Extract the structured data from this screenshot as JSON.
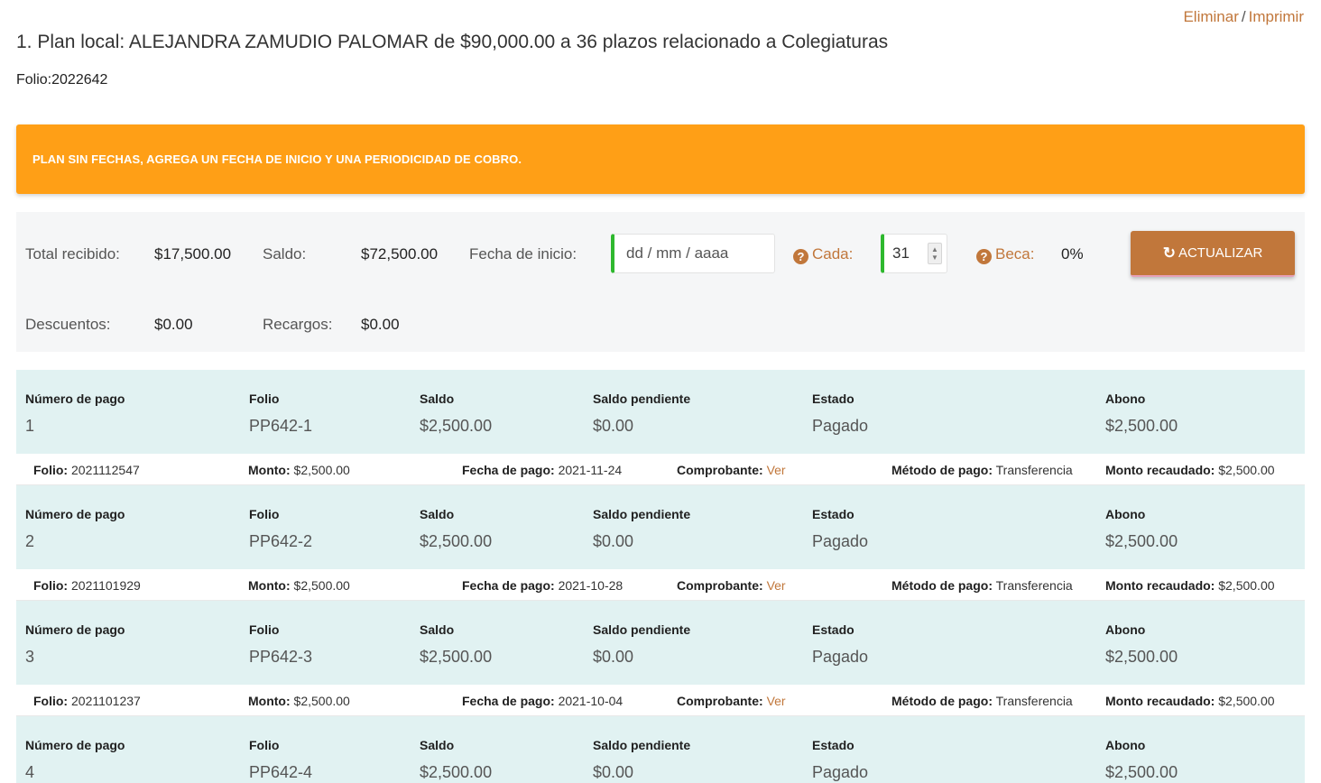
{
  "links": {
    "delete": "Eliminar",
    "separator": "/",
    "print": "Imprimir"
  },
  "title": "1. Plan local: ALEJANDRA ZAMUDIO PALOMAR de $90,000.00 a 36 plazos relacionado a Colegiaturas",
  "folio": "Folio:2022642",
  "alert": "PLAN SIN FECHAS, AGREGA UN FECHA DE INICIO Y UNA PERIODICIDAD DE COBRO.",
  "summary": {
    "total_recibido_label": "Total recibido:",
    "total_recibido": "$17,500.00",
    "saldo_label": "Saldo:",
    "saldo": "$72,500.00",
    "fecha_inicio_label": "Fecha de inicio:",
    "fecha_inicio_placeholder": "dd / mm / aaaa",
    "cada_label": "Cada:",
    "cada_value": "31",
    "beca_label": "Beca:",
    "beca_value": "0%",
    "actualizar_label": "ACTUALIZAR",
    "descuentos_label": "Descuentos:",
    "descuentos": "$0.00",
    "recargos_label": "Recargos:",
    "recargos": "$0.00"
  },
  "columns": {
    "numero": "Número de pago",
    "folio": "Folio",
    "saldo": "Saldo",
    "saldo_pendiente": "Saldo pendiente",
    "estado": "Estado",
    "abono": "Abono"
  },
  "detail_labels": {
    "folio": "Folio:",
    "monto": "Monto:",
    "fecha": "Fecha de pago:",
    "comprobante": "Comprobante:",
    "metodo": "Método de pago:",
    "recaudado": "Monto recaudado:"
  },
  "payments": [
    {
      "numero": "1",
      "folio": "PP642-1",
      "saldo": "$2,500.00",
      "saldo_pendiente": "$0.00",
      "estado": "Pagado",
      "abono": "$2,500.00",
      "detail": {
        "folio": "2021112547",
        "monto": "$2,500.00",
        "fecha": "2021-11-24",
        "comprobante": "Ver",
        "metodo": "Transferencia",
        "recaudado": "$2,500.00"
      }
    },
    {
      "numero": "2",
      "folio": "PP642-2",
      "saldo": "$2,500.00",
      "saldo_pendiente": "$0.00",
      "estado": "Pagado",
      "abono": "$2,500.00",
      "detail": {
        "folio": "2021101929",
        "monto": "$2,500.00",
        "fecha": "2021-10-28",
        "comprobante": "Ver",
        "metodo": "Transferencia",
        "recaudado": "$2,500.00"
      }
    },
    {
      "numero": "3",
      "folio": "PP642-3",
      "saldo": "$2,500.00",
      "saldo_pendiente": "$0.00",
      "estado": "Pagado",
      "abono": "$2,500.00",
      "detail": {
        "folio": "2021101237",
        "monto": "$2,500.00",
        "fecha": "2021-10-04",
        "comprobante": "Ver",
        "metodo": "Transferencia",
        "recaudado": "$2,500.00"
      }
    },
    {
      "numero": "4",
      "folio": "PP642-4",
      "saldo": "$2,500.00",
      "saldo_pendiente": "$0.00",
      "estado": "Pagado",
      "abono": "$2,500.00"
    }
  ]
}
